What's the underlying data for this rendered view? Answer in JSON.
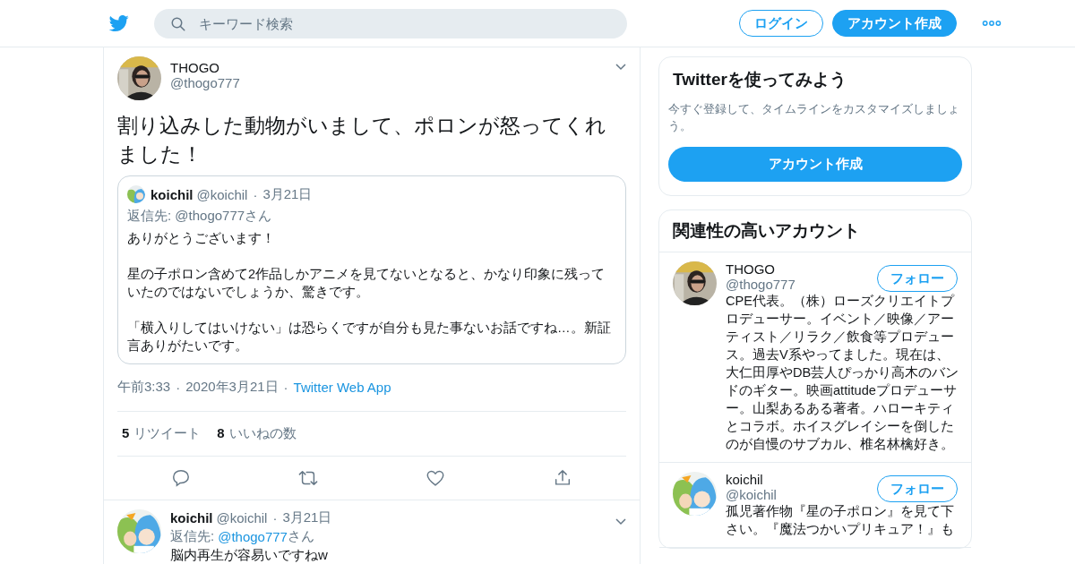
{
  "header": {
    "search_placeholder": "キーワード検索",
    "login": "ログイン",
    "signup": "アカウント作成"
  },
  "separator": "·",
  "tweet": {
    "name": "THOGO",
    "handle": "@thogo777",
    "text": "割り込みした動物がいまして、ポロンが怒ってくれました！",
    "quote": {
      "name": "koichil",
      "handle": "@koichil",
      "date": "3月21日",
      "reply_line": "返信先: @thogo777さん",
      "paragraphs": [
        "ありがとうございます！",
        "星の子ポロン含めて2作品しかアニメを見てないとなると、かなり印象に残っていたのではないでしょうか、驚きです。",
        "「横入りしてはいけない」は恐らくですが自分も見た事ないお話ですね…。新証言ありがたいです。"
      ]
    },
    "time": "午前3:33",
    "date": "2020年3月21日",
    "source": "Twitter Web App",
    "stats": [
      {
        "count": "5",
        "label": "リツイート"
      },
      {
        "count": "8",
        "label": "いいねの数"
      }
    ]
  },
  "reply": {
    "name": "koichil",
    "handle": "@koichil",
    "date": "3月21日",
    "reply_label": "返信先:",
    "reply_to": "@thogo777",
    "reply_suffix": "さん",
    "text": "脳内再生が容易いですねw"
  },
  "sidebar": {
    "signup_card": {
      "title": "Twitterを使ってみよう",
      "text": "今すぐ登録して、タイムラインをカスタマイズしましょう。",
      "button": "アカウント作成"
    },
    "related": {
      "title": "関連性の高いアカウント",
      "accounts": [
        {
          "name": "THOGO",
          "handle": "@thogo777",
          "follow": "フォロー",
          "bio": "CPE代表。（株）ローズクリエイトプロデューサー。イベント／映像／アーティスト／リラク／飲食等プロデュース。過去V系やってました。現在は、大仁田厚やDB芸人ぴっかり高木のバンドのギター。映画attitudeプロデューサー。山梨あるある著者。ハローキティとコラボ。ホイスグレイシーを倒したのが自慢のサブカル、椎名林檎好き。"
        },
        {
          "name": "koichil",
          "handle": "@koichil",
          "follow": "フォロー",
          "bio": "孤児著作物『星の子ポロン』を見て下さい。『魔法つかいプリキュア！』も"
        }
      ]
    }
  }
}
